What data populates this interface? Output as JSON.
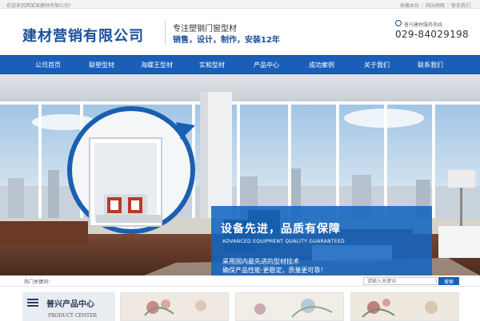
{
  "topbar": {
    "welcome": "欢迎来到西某某建材有限公司！",
    "links": [
      "收藏本站",
      "网站地图",
      "联系我们"
    ]
  },
  "header": {
    "logo": "建材营销有限公司",
    "slogan_line1": "专注塑钢门窗型材",
    "slogan_line2": "销售，设计，制作，安装12年",
    "hotline_label": "普兴建材服务热线",
    "hotline_number": "029-84029198"
  },
  "nav": {
    "items": [
      "公司首页",
      "联塑型材",
      "海螺王型材",
      "实和型材",
      "产品中心",
      "成功案例",
      "关于我们",
      "联系我们"
    ]
  },
  "banner": {
    "headline": "设备先进，品质有保障",
    "headline_en": "ADVANCED EQUIPMENT QUALITY GUARANTEED",
    "sub_line1": "采用国内最先进的型材技术",
    "sub_line2": "确保产品性能·更稳定，质量更可靠！"
  },
  "search": {
    "hot_label": "热门关键词：",
    "placeholder": "请输入关键词",
    "button": "搜索"
  },
  "product_center": {
    "title": "普兴产品中心",
    "subtitle": "PRODUCT CENTER"
  },
  "colors": {
    "brand_blue": "#1a5eb8",
    "logo_blue": "#1b4f98",
    "banner_overlay": "#1565c0"
  },
  "icons": [
    "phone-icon",
    "menu-list-icon"
  ]
}
